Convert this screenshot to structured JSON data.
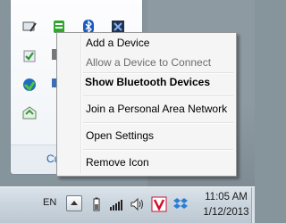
{
  "tray_flyout": {
    "customize_link": "Cu",
    "icons": [
      "monitor-pen-icon",
      "green-bars-icon",
      "bluetooth-icon",
      "network-blue-icon",
      "check-shield-icon",
      "kb-icon",
      "update-globe-icon",
      "envelope-icon",
      "onedrive-icon"
    ]
  },
  "context_menu": {
    "items": [
      {
        "label": "Add a Device",
        "enabled": true,
        "bold": false
      },
      {
        "label": "Allow a Device to Connect",
        "enabled": false,
        "bold": false
      },
      {
        "label": "Show Bluetooth Devices",
        "enabled": true,
        "bold": true
      },
      {
        "label": "Join a Personal Area Network",
        "enabled": true,
        "bold": false
      },
      {
        "label": "Open Settings",
        "enabled": true,
        "bold": false
      },
      {
        "label": "Remove Icon",
        "enabled": true,
        "bold": false
      }
    ]
  },
  "taskbar": {
    "language": "EN",
    "clock_time": "11:05 AM",
    "clock_date": "1/12/2013"
  },
  "colors": {
    "desktop": "#86949c",
    "menu_background": "#f5f5f5",
    "disabled_text": "#6d6d6d",
    "link": "#1a5fa8"
  }
}
